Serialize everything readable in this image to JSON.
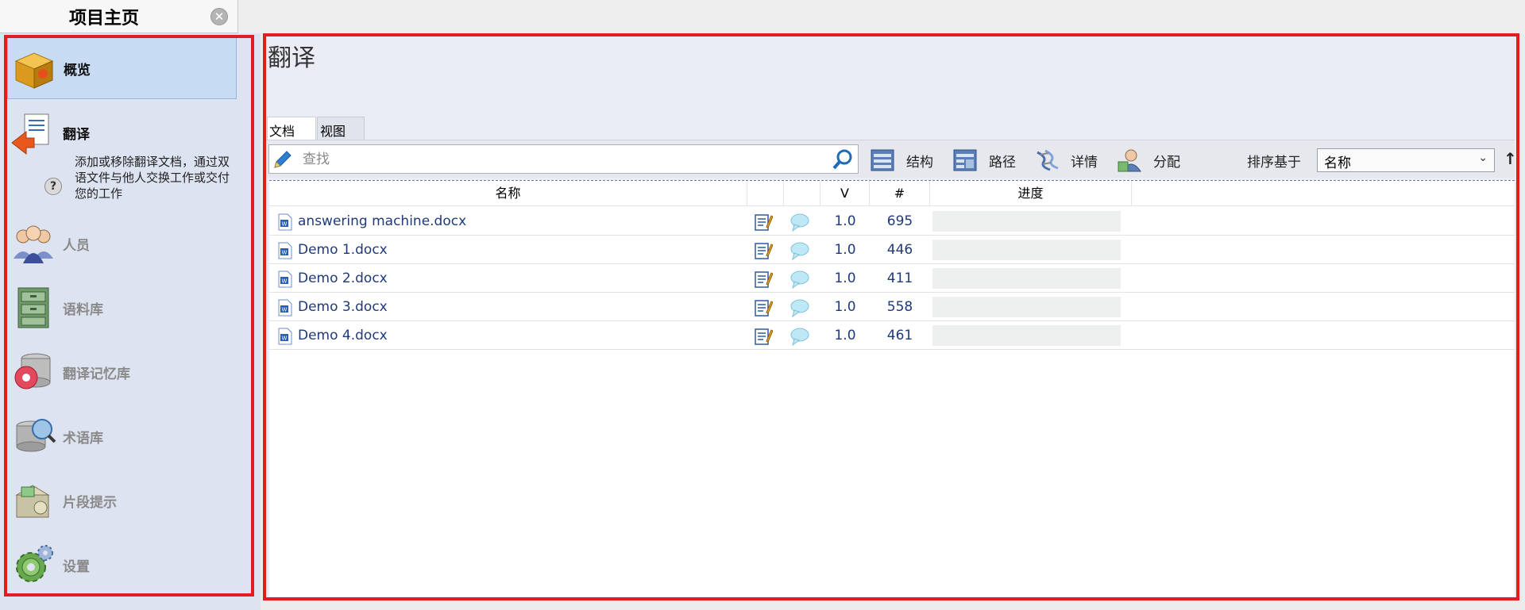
{
  "home_tab": {
    "title": "项目主页"
  },
  "sidebar": {
    "items": [
      {
        "label": "概览",
        "icon": "overview-box-icon"
      },
      {
        "label": "翻译",
        "icon": "translation-docs-icon",
        "description": "添加或移除翻译文档，通过双语文件与他人交换工作或交付您的工作"
      },
      {
        "label": "人员",
        "icon": "people-icon"
      },
      {
        "label": "语料库",
        "icon": "file-cabinet-icon"
      },
      {
        "label": "翻译记忆库",
        "icon": "translation-memory-icon"
      },
      {
        "label": "术语库",
        "icon": "term-base-icon"
      },
      {
        "label": "片段提示",
        "icon": "muse-icon"
      },
      {
        "label": "设置",
        "icon": "gear-icon"
      }
    ]
  },
  "main": {
    "title": "翻译",
    "tabs": [
      {
        "label": "文档"
      },
      {
        "label": "视图"
      }
    ],
    "search": {
      "placeholder": "查找",
      "value": ""
    },
    "toolbar": {
      "structure": "结构",
      "path": "路径",
      "details": "详情",
      "assign": "分配",
      "sort_label": "排序基于",
      "sort_value": "名称"
    },
    "table": {
      "headers": {
        "name": "名称",
        "version": "V",
        "count": "#",
        "progress": "进度"
      },
      "rows": [
        {
          "name": "answering machine.docx",
          "version": "1.0",
          "count": "695",
          "progress": 0
        },
        {
          "name": "Demo 1.docx",
          "version": "1.0",
          "count": "446",
          "progress": 0
        },
        {
          "name": "Demo 2.docx",
          "version": "1.0",
          "count": "411",
          "progress": 0
        },
        {
          "name": "Demo 3.docx",
          "version": "1.0",
          "count": "558",
          "progress": 0
        },
        {
          "name": "Demo 4.docx",
          "version": "1.0",
          "count": "461",
          "progress": 0
        }
      ]
    }
  }
}
